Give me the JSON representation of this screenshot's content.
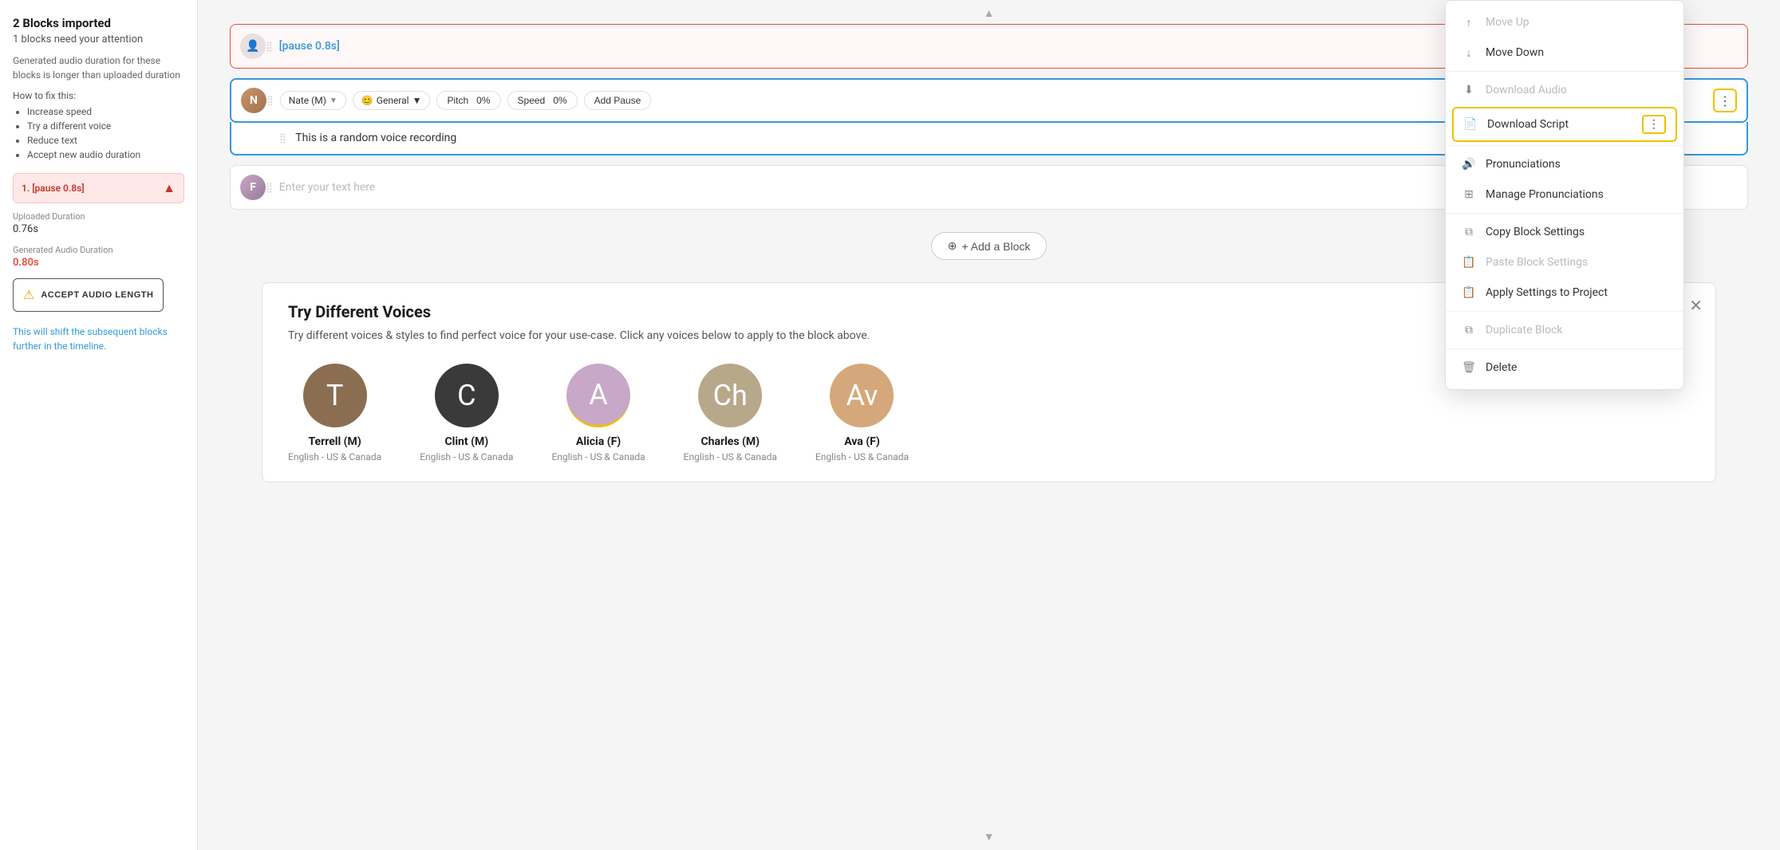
{
  "sidebar": {
    "title": "2 Blocks imported",
    "subtitle": "1 blocks need your attention",
    "description": "Generated audio duration for these blocks is longer than uploaded duration",
    "how_to_fix": "How to fix this:",
    "fixes": [
      "Increase speed",
      "Try a different voice",
      "Reduce text",
      "Accept new audio duration"
    ],
    "block_item": {
      "label": "1. [pause 0.8s]",
      "arrow": "▲"
    },
    "uploaded_duration_label": "Uploaded Duration",
    "uploaded_duration_value": "0.76s",
    "generated_duration_label": "Generated Audio Duration",
    "generated_duration_value": "0.80s",
    "accept_btn_label": "ACCEPT AUDIO LENGTH",
    "shift_note": "This will shift the subsequent blocks further in the timeline."
  },
  "blocks": [
    {
      "id": "block1",
      "type": "pause",
      "text": "[pause 0.8s]",
      "state": "error"
    },
    {
      "id": "block2",
      "type": "voice",
      "voice": "Nate (M)",
      "style": "General",
      "pitch_label": "Pitch",
      "pitch_value": "0%",
      "speed_label": "Speed",
      "speed_value": "0%",
      "add_pause_label": "Add Pause",
      "text": "This is a random voice recording",
      "state": "active"
    },
    {
      "id": "block3",
      "type": "voice",
      "text": "",
      "placeholder": "Enter your text here",
      "state": "normal"
    }
  ],
  "add_block_btn": "+ Add a Block",
  "voices_panel": {
    "title": "Try Different Voices",
    "description": "Try different voices & styles to find perfect voice for your use-case. Click any voices below to apply to the block above.",
    "voices": [
      {
        "name": "Terrell (M)",
        "lang": "English - US & Canada",
        "type": "terrell",
        "initial": "T"
      },
      {
        "name": "Clint (M)",
        "lang": "English - US & Canada",
        "type": "clint",
        "initial": "C"
      },
      {
        "name": "Alicia (F)",
        "lang": "English - US & Canada",
        "type": "alicia",
        "initial": "A"
      },
      {
        "name": "Charles (M)",
        "lang": "English - US & Canada",
        "type": "charles",
        "initial": "Ch"
      },
      {
        "name": "Ava (F)",
        "lang": "English - US & Canada",
        "type": "ava",
        "initial": "Av"
      }
    ]
  },
  "dropdown": {
    "items": [
      {
        "id": "move-up",
        "label": "Move Up",
        "icon": "↑",
        "disabled": true
      },
      {
        "id": "move-down",
        "label": "Move Down",
        "icon": "↓",
        "disabled": false
      },
      {
        "id": "download-audio",
        "label": "Download Audio",
        "icon": "⬇",
        "disabled": true
      },
      {
        "id": "download-script",
        "label": "Download Script",
        "icon": "📄",
        "disabled": false,
        "highlighted": true
      },
      {
        "id": "pronunciations",
        "label": "Pronunciations",
        "icon": "🔊",
        "disabled": false
      },
      {
        "id": "manage-pronunciations",
        "label": "Manage Pronunciations",
        "icon": "⊞",
        "disabled": false
      },
      {
        "id": "copy-block",
        "label": "Copy Block Settings",
        "icon": "⧉",
        "disabled": false
      },
      {
        "id": "paste-block",
        "label": "Paste Block Settings",
        "icon": "📋",
        "disabled": true
      },
      {
        "id": "apply-settings",
        "label": "Apply Settings to Project",
        "icon": "📋",
        "disabled": false
      },
      {
        "id": "duplicate",
        "label": "Duplicate Block",
        "icon": "⧉",
        "disabled": true
      },
      {
        "id": "delete",
        "label": "Delete",
        "icon": "🗑",
        "disabled": false
      }
    ]
  }
}
